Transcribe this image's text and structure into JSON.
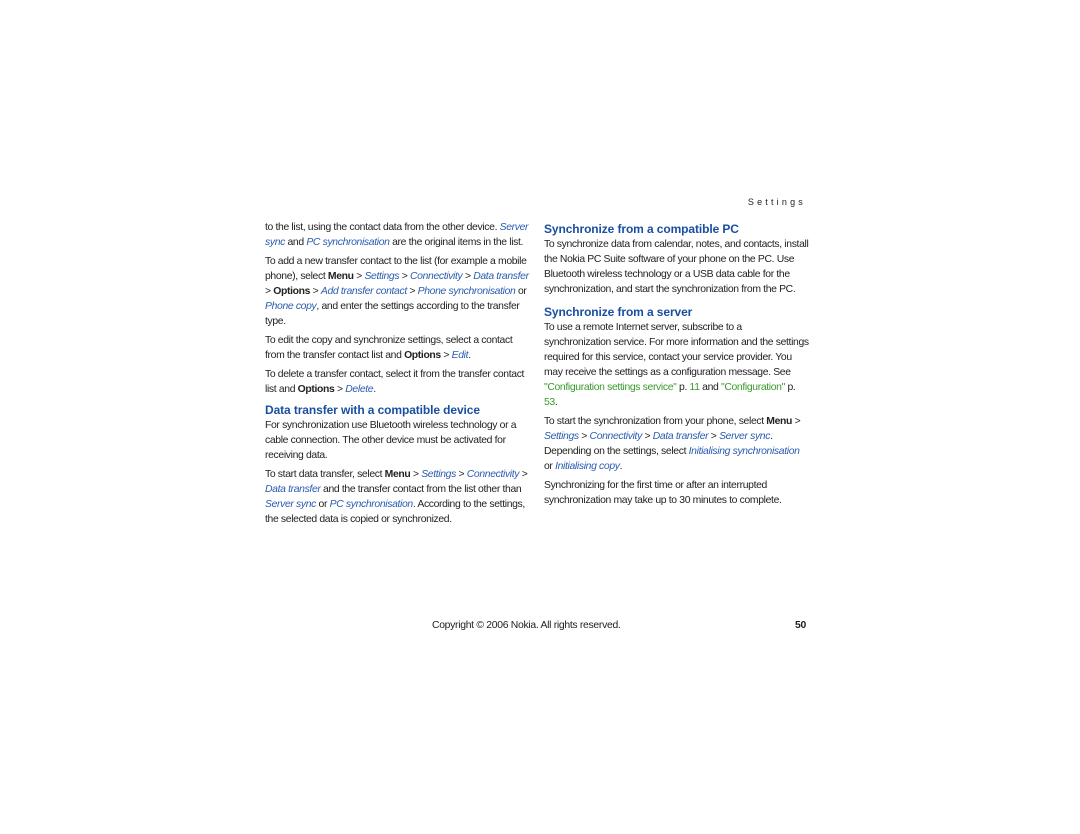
{
  "header": {
    "section": "Settings"
  },
  "left": {
    "p1": {
      "t1": "to the list, using the contact data from the other device.",
      "i1": "Server sync",
      "t2": " and ",
      "i2": "PC synchronisation",
      "t3": " are the original items in the list."
    },
    "p2": {
      "t1": "To add a new transfer contact to the list (for example a mobile phone), select ",
      "b1": "Menu",
      "s1": " > ",
      "i1": "Settings",
      "s2": " > ",
      "i2": "Connectivity",
      "s3": " > ",
      "i3": "Data transfer",
      "s4": " > ",
      "b2": "Options",
      "s5": " > ",
      "i4": "Add transfer contact",
      "s6": " > ",
      "i5": "Phone synchronisation",
      "t2": " or ",
      "i6": "Phone copy",
      "t3": ", and enter the settings according to the transfer type."
    },
    "p3": {
      "t1": "To edit the copy and synchronize settings, select a contact from the transfer contact list and ",
      "b1": "Options",
      "s1": " > ",
      "i1": "Edit",
      "t2": "."
    },
    "p4": {
      "t1": "To delete a transfer contact, select it from the transfer contact list and ",
      "b1": "Options",
      "s1": " > ",
      "i1": "Delete",
      "t2": "."
    },
    "h1": "Data transfer with a compatible device",
    "p5": "For synchronization use Bluetooth wireless technology or a cable connection. The other device must be activated for receiving data.",
    "p6": {
      "t1": "To start data transfer, select ",
      "b1": "Menu",
      "s1": " > ",
      "i1": "Settings",
      "s2": " > ",
      "i2": "Connectivity",
      "s3": " > ",
      "i3": "Data transfer",
      "t2": " and the transfer contact from the list other than ",
      "i4": "Server sync",
      "t3": " or ",
      "i5": "PC synchronisation",
      "t4": ". According to the settings, the selected data is copied or synchronized."
    }
  },
  "right": {
    "h1": "Synchronize from a compatible PC",
    "p1": "To synchronize data from calendar, notes, and contacts, install the Nokia PC Suite software of your phone on the PC. Use Bluetooth wireless technology or a USB data cable for the synchronization, and start the synchronization from the PC.",
    "h2": "Synchronize from a server",
    "p2": {
      "t1": "To use a remote Internet server, subscribe to a synchronization service. For more information and the settings required for this service, contact your service provider. You may receive the settings as a configuration message. See ",
      "x1": "\"Configuration settings service\"",
      "t2": " p. ",
      "x2": "11",
      "t3": " and ",
      "x3": "\"Configuration\"",
      "t4": " p. ",
      "x4": "53",
      "t5": "."
    },
    "p3": {
      "t1": "To start the synchronization from your phone, select ",
      "b1": "Menu",
      "s1": " > ",
      "i1": "Settings",
      "s2": " > ",
      "i2": "Connectivity",
      "s3": " > ",
      "i3": "Data transfer",
      "s4": " > ",
      "i4": "Server sync",
      "t2": ". Depending on the settings, select ",
      "i5": "Initialising synchronisation",
      "t3": " or ",
      "i6": "Initialising copy",
      "t4": "."
    },
    "p4": "Synchronizing for the first time or after an interrupted synchronization may take up to 30 minutes to complete."
  },
  "footer": {
    "copyright": "Copyright © 2006 Nokia. All rights reserved.",
    "page_number": "50"
  }
}
